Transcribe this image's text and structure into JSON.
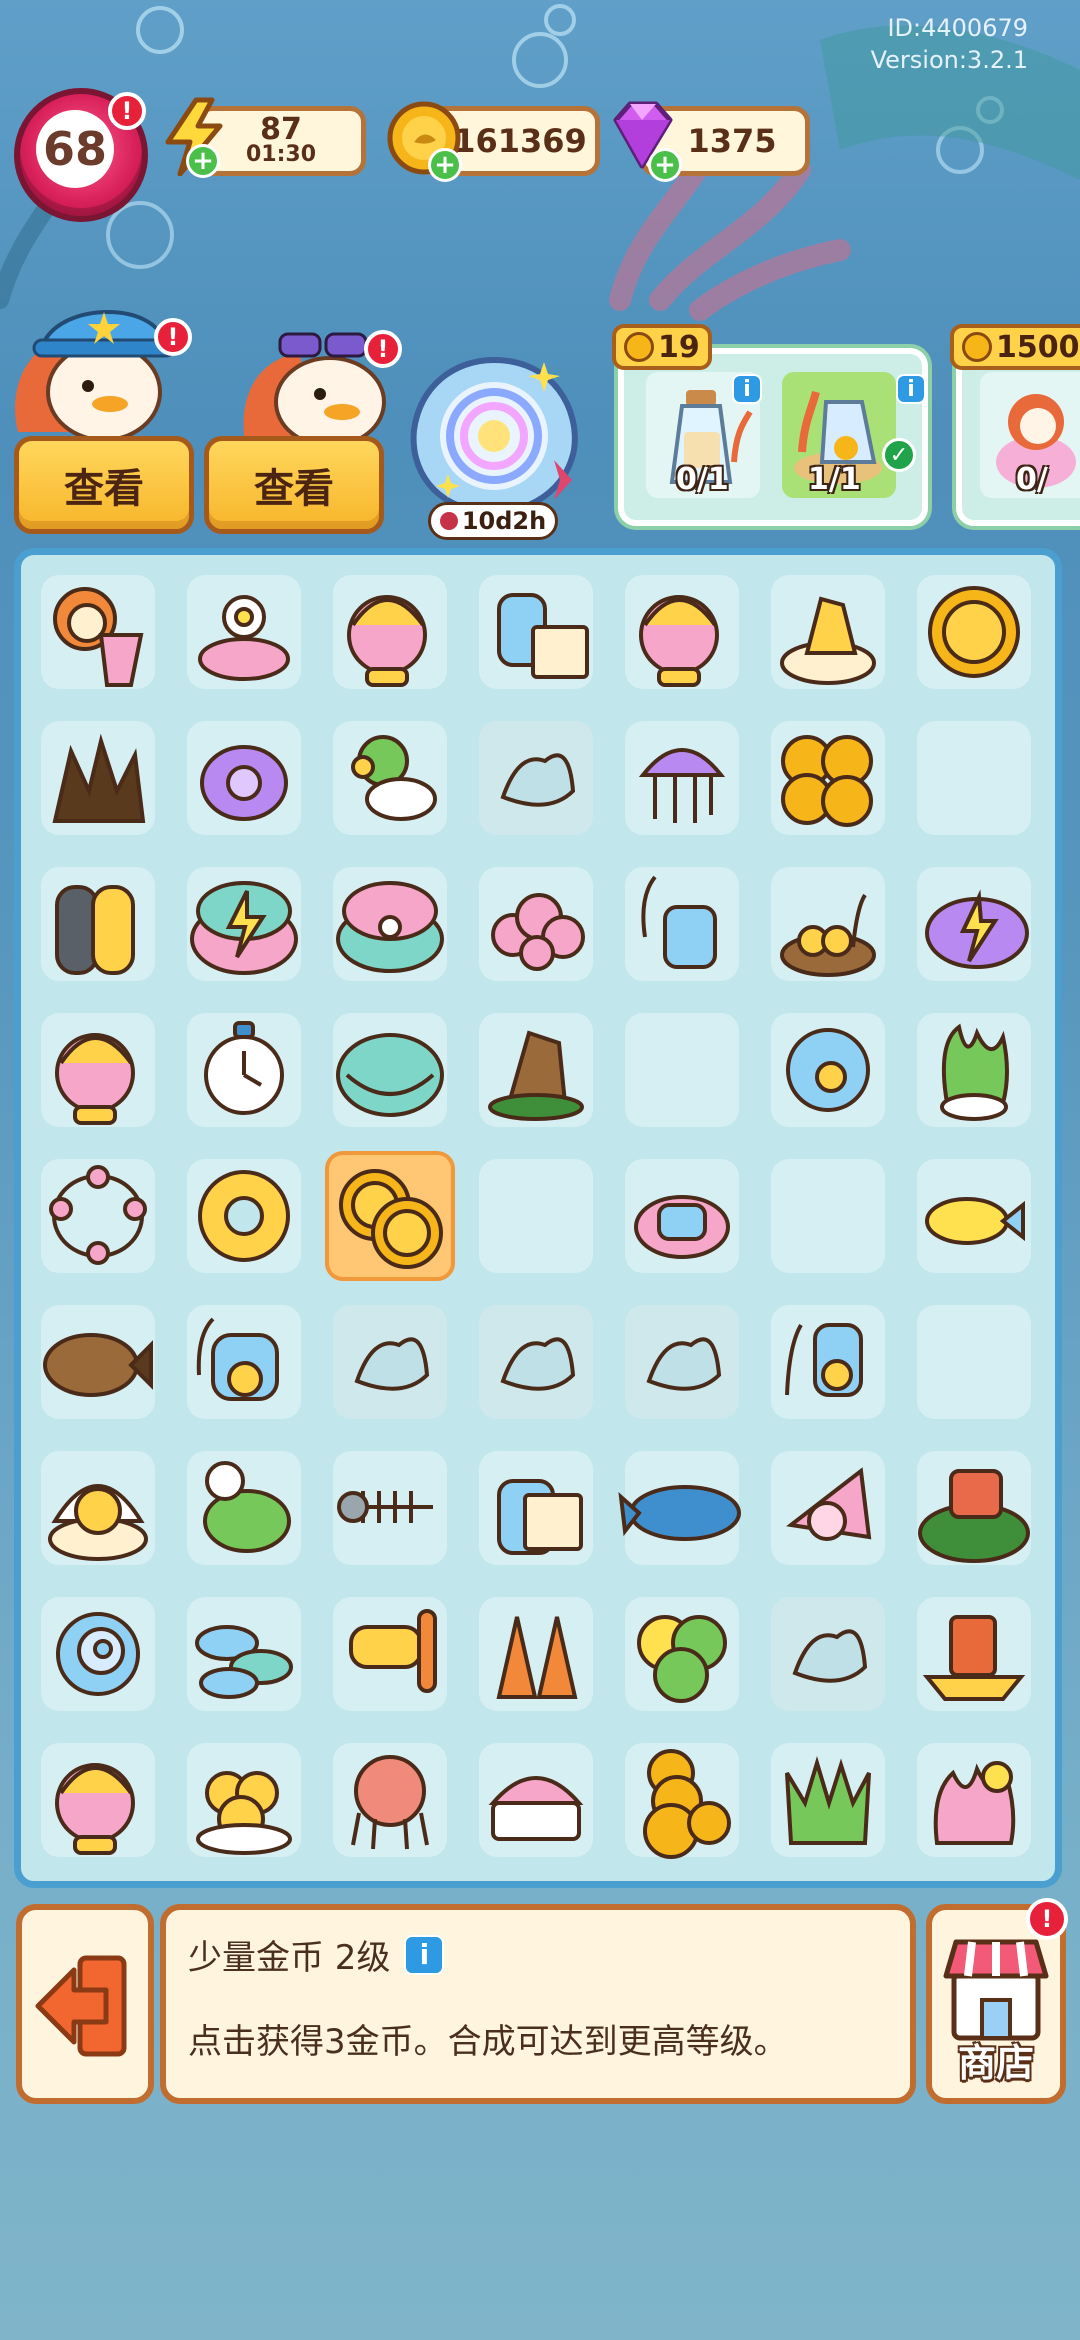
{
  "meta": {
    "id": "ID:4400679",
    "version": "Version:3.2.1"
  },
  "hud": {
    "level": "68",
    "energy": {
      "value": "87",
      "timer": "01:30"
    },
    "coins": "161369",
    "gems": "1375"
  },
  "characters": {
    "left": {
      "button": "查看"
    },
    "right": {
      "button": "查看"
    }
  },
  "portal": {
    "timer": "10d2h"
  },
  "orders": [
    {
      "reward": "19",
      "slots": [
        {
          "count": "0/1",
          "done": false
        },
        {
          "count": "1/1",
          "done": true
        }
      ]
    },
    {
      "reward": "1500",
      "slots": [
        {
          "count": "0/",
          "done": false
        }
      ]
    }
  ],
  "board": {
    "rows": [
      [
        "mermaid-harp",
        "flower-shell",
        "octopus-headphones",
        "message-bottle-scroll",
        "octopus-headphones",
        "gold-nugget-shell",
        "gold-coin"
      ],
      [
        "dark-coral",
        "purple-seahorse",
        "green-coral-fish",
        "locked",
        "jellyfish",
        "coin-pile",
        "empty"
      ],
      [
        "scuba-tank",
        "clam-energy",
        "pearl-clam",
        "pink-pearls",
        "bottle-coral",
        "gold-nugget-nest",
        "whale-energy"
      ],
      [
        "octopus-headphones",
        "stopwatch",
        "clam-shell",
        "bronze-shell",
        "empty",
        "golden-egg-bubble",
        "seaweed-pot"
      ],
      [
        "pearl-necklace",
        "swim-ring",
        "two-coins",
        "empty",
        "pink-coral-jar",
        "empty",
        "yellow-fish"
      ],
      [
        "bronze-fish",
        "bottle-gold",
        "locked",
        "locked",
        "locked",
        "coral-gold-jar",
        "empty"
      ],
      [
        "gold-shell-nest",
        "puffer-fish",
        "fish-skeleton",
        "music-bottle",
        "dolphin",
        "pink-conch",
        "turtle-island"
      ],
      [
        "swirl-shell",
        "fish-school",
        "snorkel-mask",
        "flippers",
        "coral-sponge",
        "locked",
        "golden-ship"
      ],
      [
        "octopus-headphones",
        "gold-nugget-pile",
        "small-octopus",
        "shell-piano",
        "coin-stack",
        "green-anemone",
        "pink-coral-star"
      ]
    ],
    "selected": "two-coins"
  },
  "info": {
    "title": "少量金币 2级",
    "description": "点击获得3金币。合成可达到更高等级。"
  },
  "shop": {
    "label": "商店"
  },
  "colors": {
    "accent": "#4b9fd0",
    "gold": "#f7b52a",
    "panel_border": "#c06d2f"
  }
}
